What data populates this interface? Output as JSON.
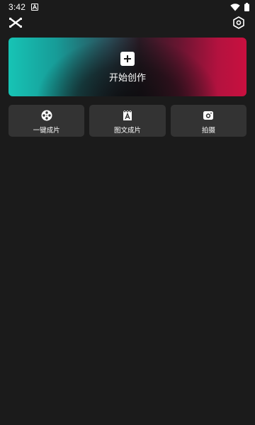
{
  "status_bar": {
    "time": "3:42",
    "icons": [
      "notification-a-icon",
      "wifi-icon",
      "battery-icon"
    ]
  },
  "top_bar": {
    "logo_icon": "capcut-logo-icon",
    "settings_icon": "settings-hexagon-icon"
  },
  "create_banner": {
    "icon": "plus-icon",
    "label": "开始创作",
    "colors": {
      "start": "#17c4b5",
      "middle": "#1a1418",
      "end": "#c9103f"
    }
  },
  "quick_actions": [
    {
      "icon": "film-reel-icon",
      "label": "一键成片"
    },
    {
      "icon": "text-image-icon",
      "label": "图文成片"
    },
    {
      "icon": "camera-icon",
      "label": "拍摄"
    }
  ],
  "theme": {
    "background": "#1b1b1b",
    "card": "#333333",
    "text": "#ffffff"
  }
}
